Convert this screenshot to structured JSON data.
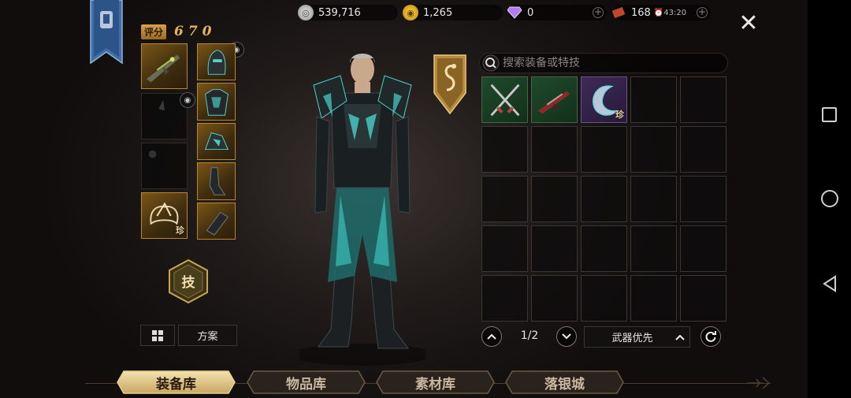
{
  "currencies": {
    "silver": "539,716",
    "gold": "1,265",
    "diamond": "0",
    "ticket": "168",
    "ticket_timer": "43:20"
  },
  "score": {
    "label": "评分",
    "value": "670"
  },
  "equipment": {
    "rare_tag": "珍",
    "skill_label": "技",
    "plan_label": "方案"
  },
  "search": {
    "placeholder": "搜索装备或特技"
  },
  "inventory": {
    "rare_tag": "珍",
    "page": "1/2",
    "sort_label": "武器优先"
  },
  "tabs": [
    {
      "label": "装备库",
      "active": true
    },
    {
      "label": "物品库",
      "active": false
    },
    {
      "label": "素材库",
      "active": false
    },
    {
      "label": "落银城",
      "active": false
    }
  ],
  "colors": {
    "accent_gold": "#e7b45a",
    "rare_green": "#1f4a2a",
    "rare_purple": "#3f2a57",
    "banner_blue": "#3f6ea8"
  }
}
